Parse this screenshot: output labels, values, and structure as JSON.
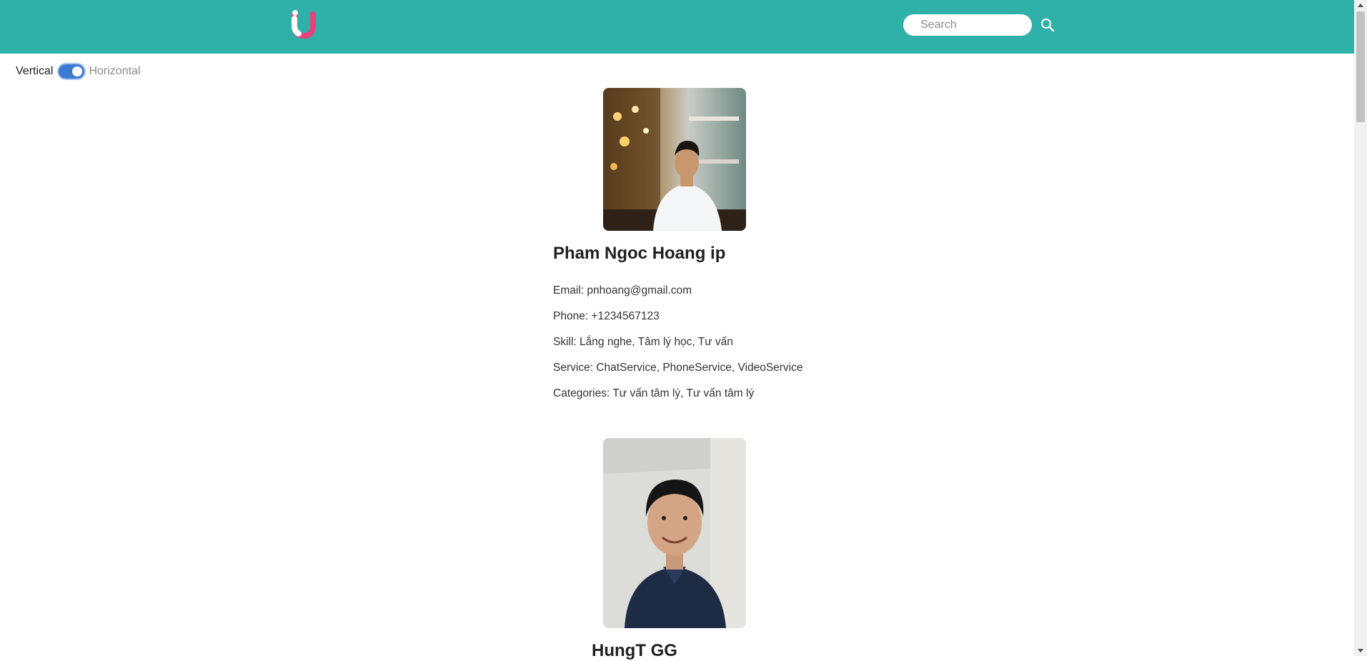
{
  "header": {
    "logo_alt": "U",
    "search": {
      "placeholder": "Search",
      "value": ""
    },
    "colors": {
      "bar": "#2fb1aa",
      "logo_pink": "#e8417c",
      "logo_white": "#ffffff"
    }
  },
  "layout_toggle": {
    "left_label": "Vertical",
    "right_label": "Horizontal",
    "state": "on"
  },
  "profiles": [
    {
      "photo_icon": "person-photo-bar-background",
      "name": "Pham Ngoc Hoang ip",
      "email_line": "Email: pnhoang@gmail.com",
      "phone_line": "Phone: +1234567123",
      "skill_line": "Skill: Lắng nghe, Tâm lý học, Tư vấn",
      "service_line": "Service: ChatService, PhoneService, VideoService",
      "categories_line": "Categories: Tư vấn tâm lý, Tư vấn tâm lý"
    },
    {
      "photo_icon": "person-photo-wall-background",
      "name": "HungT GG"
    }
  ]
}
